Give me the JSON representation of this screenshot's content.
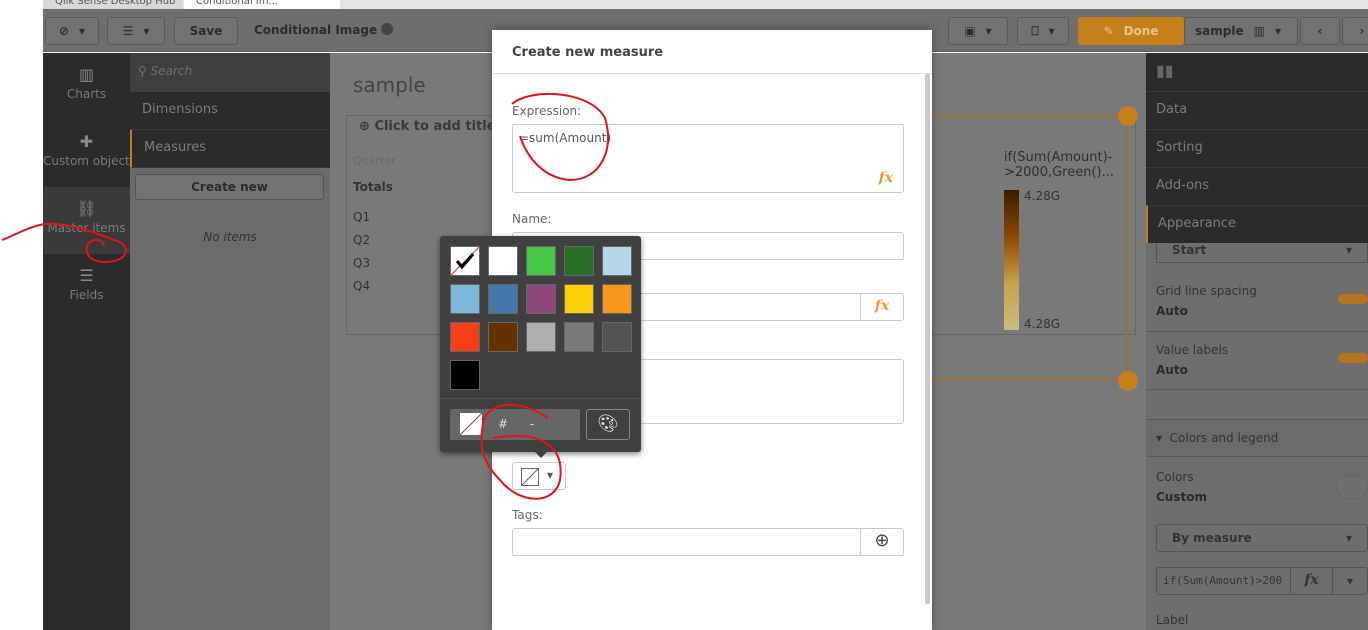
{
  "window_tabs": [
    "Qlik Sense Desktop Hub",
    "Conditional Im..."
  ],
  "toolbar": {
    "save_label": "Save",
    "app_title": "Conditional Image",
    "done_label": "Done",
    "sheet_name": "sample"
  },
  "leftnav": [
    {
      "label": "Charts",
      "icon": "bar-chart-icon"
    },
    {
      "label": "Custom objects",
      "icon": "puzzle-icon"
    },
    {
      "label": "Master items",
      "icon": "link-icon"
    },
    {
      "label": "Fields",
      "icon": "database-icon"
    }
  ],
  "assets": {
    "search_placeholder": "Search",
    "dimensions": "Dimensions",
    "measures": "Measures",
    "create_new": "Create new",
    "empty": "No items"
  },
  "sheet": {
    "title": "sample",
    "add_title": "Click to add title",
    "column_placeholder": "Quarter",
    "totals": "Totals",
    "rows": [
      "Q1",
      "Q2",
      "Q3",
      "Q4"
    ],
    "legend_title": "if(Sum(Amount)->2000,Green()...",
    "legend_max": "4.28G",
    "legend_min": "4.28G"
  },
  "rightpanel": {
    "tabs": [
      "Data",
      "Sorting",
      "Add-ons",
      "Appearance"
    ],
    "start_select": "Start",
    "grid_label": "Grid line spacing",
    "grid_value": "Auto",
    "value_labels": "Value labels",
    "value_labels_value": "Auto",
    "section": "Colors and legend",
    "colors_label": "Colors",
    "colors_value": "Custom",
    "by_measure": "By measure",
    "expression": "if(Sum(Amount)>200",
    "label": "Label"
  },
  "modal": {
    "title": "Create new measure",
    "expression_label": "Expression:",
    "expression_value": "=sum(Amount)",
    "name_label": "Name:",
    "name_value": "",
    "tags_label": "Tags:",
    "fx": "fx"
  },
  "colorpicker": {
    "swatches": [
      "none",
      "#ffffff",
      "#46c646",
      "#276e27",
      "#b6d7ea",
      "#7db8da",
      "#4477aa",
      "#8e477d",
      "#ffcf02",
      "#f8981d",
      "#f93f17",
      "#663300",
      "#b0afae",
      "#7b7a78",
      "#545352",
      "#000000"
    ],
    "hash": "#",
    "hex_value": "-",
    "selected": "none"
  },
  "accent": "#c5801b"
}
